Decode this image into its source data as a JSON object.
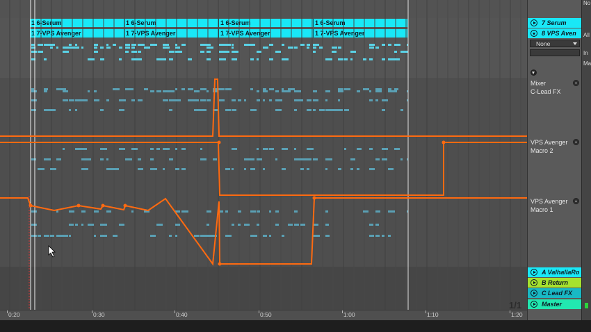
{
  "clips": {
    "row1": [
      "1 6-Serum",
      "1 6-Serum",
      "1 6-Serum",
      "1 6-Serum"
    ],
    "row2": [
      "1 7-VPS Avenger",
      "1 7-VPS Avenger",
      "1 7-VPS Avenger",
      "1 7-VPS Avenger"
    ]
  },
  "tracks": {
    "serum": "7 Serum",
    "avenger": "8 VPS Aven",
    "device_select": "None",
    "return_a": "A ValhallaRo",
    "return_b": "B Return",
    "return_c": "C Lead FX",
    "master": "Master"
  },
  "automation": {
    "lane1": {
      "device": "Mixer",
      "param": "C-Lead FX"
    },
    "lane2": {
      "device": "VPS Avenger",
      "param": "Macro 2"
    },
    "lane3": {
      "device": "VPS Avenger",
      "param": "Macro 1"
    }
  },
  "ruler_labels": [
    "0:20",
    "0:30",
    "0:40",
    "0:50",
    "1:00",
    "1:10",
    "1:20"
  ],
  "page_indicator": "1/1",
  "edge_labels": [
    "No",
    "All",
    "In",
    "Ma"
  ],
  "colors": {
    "clip": "#19e8f7",
    "automation": "#ff6a10",
    "notes": "#5fa4b8",
    "master_track": "#22e8b0",
    "return_b": "#a6e22e"
  }
}
